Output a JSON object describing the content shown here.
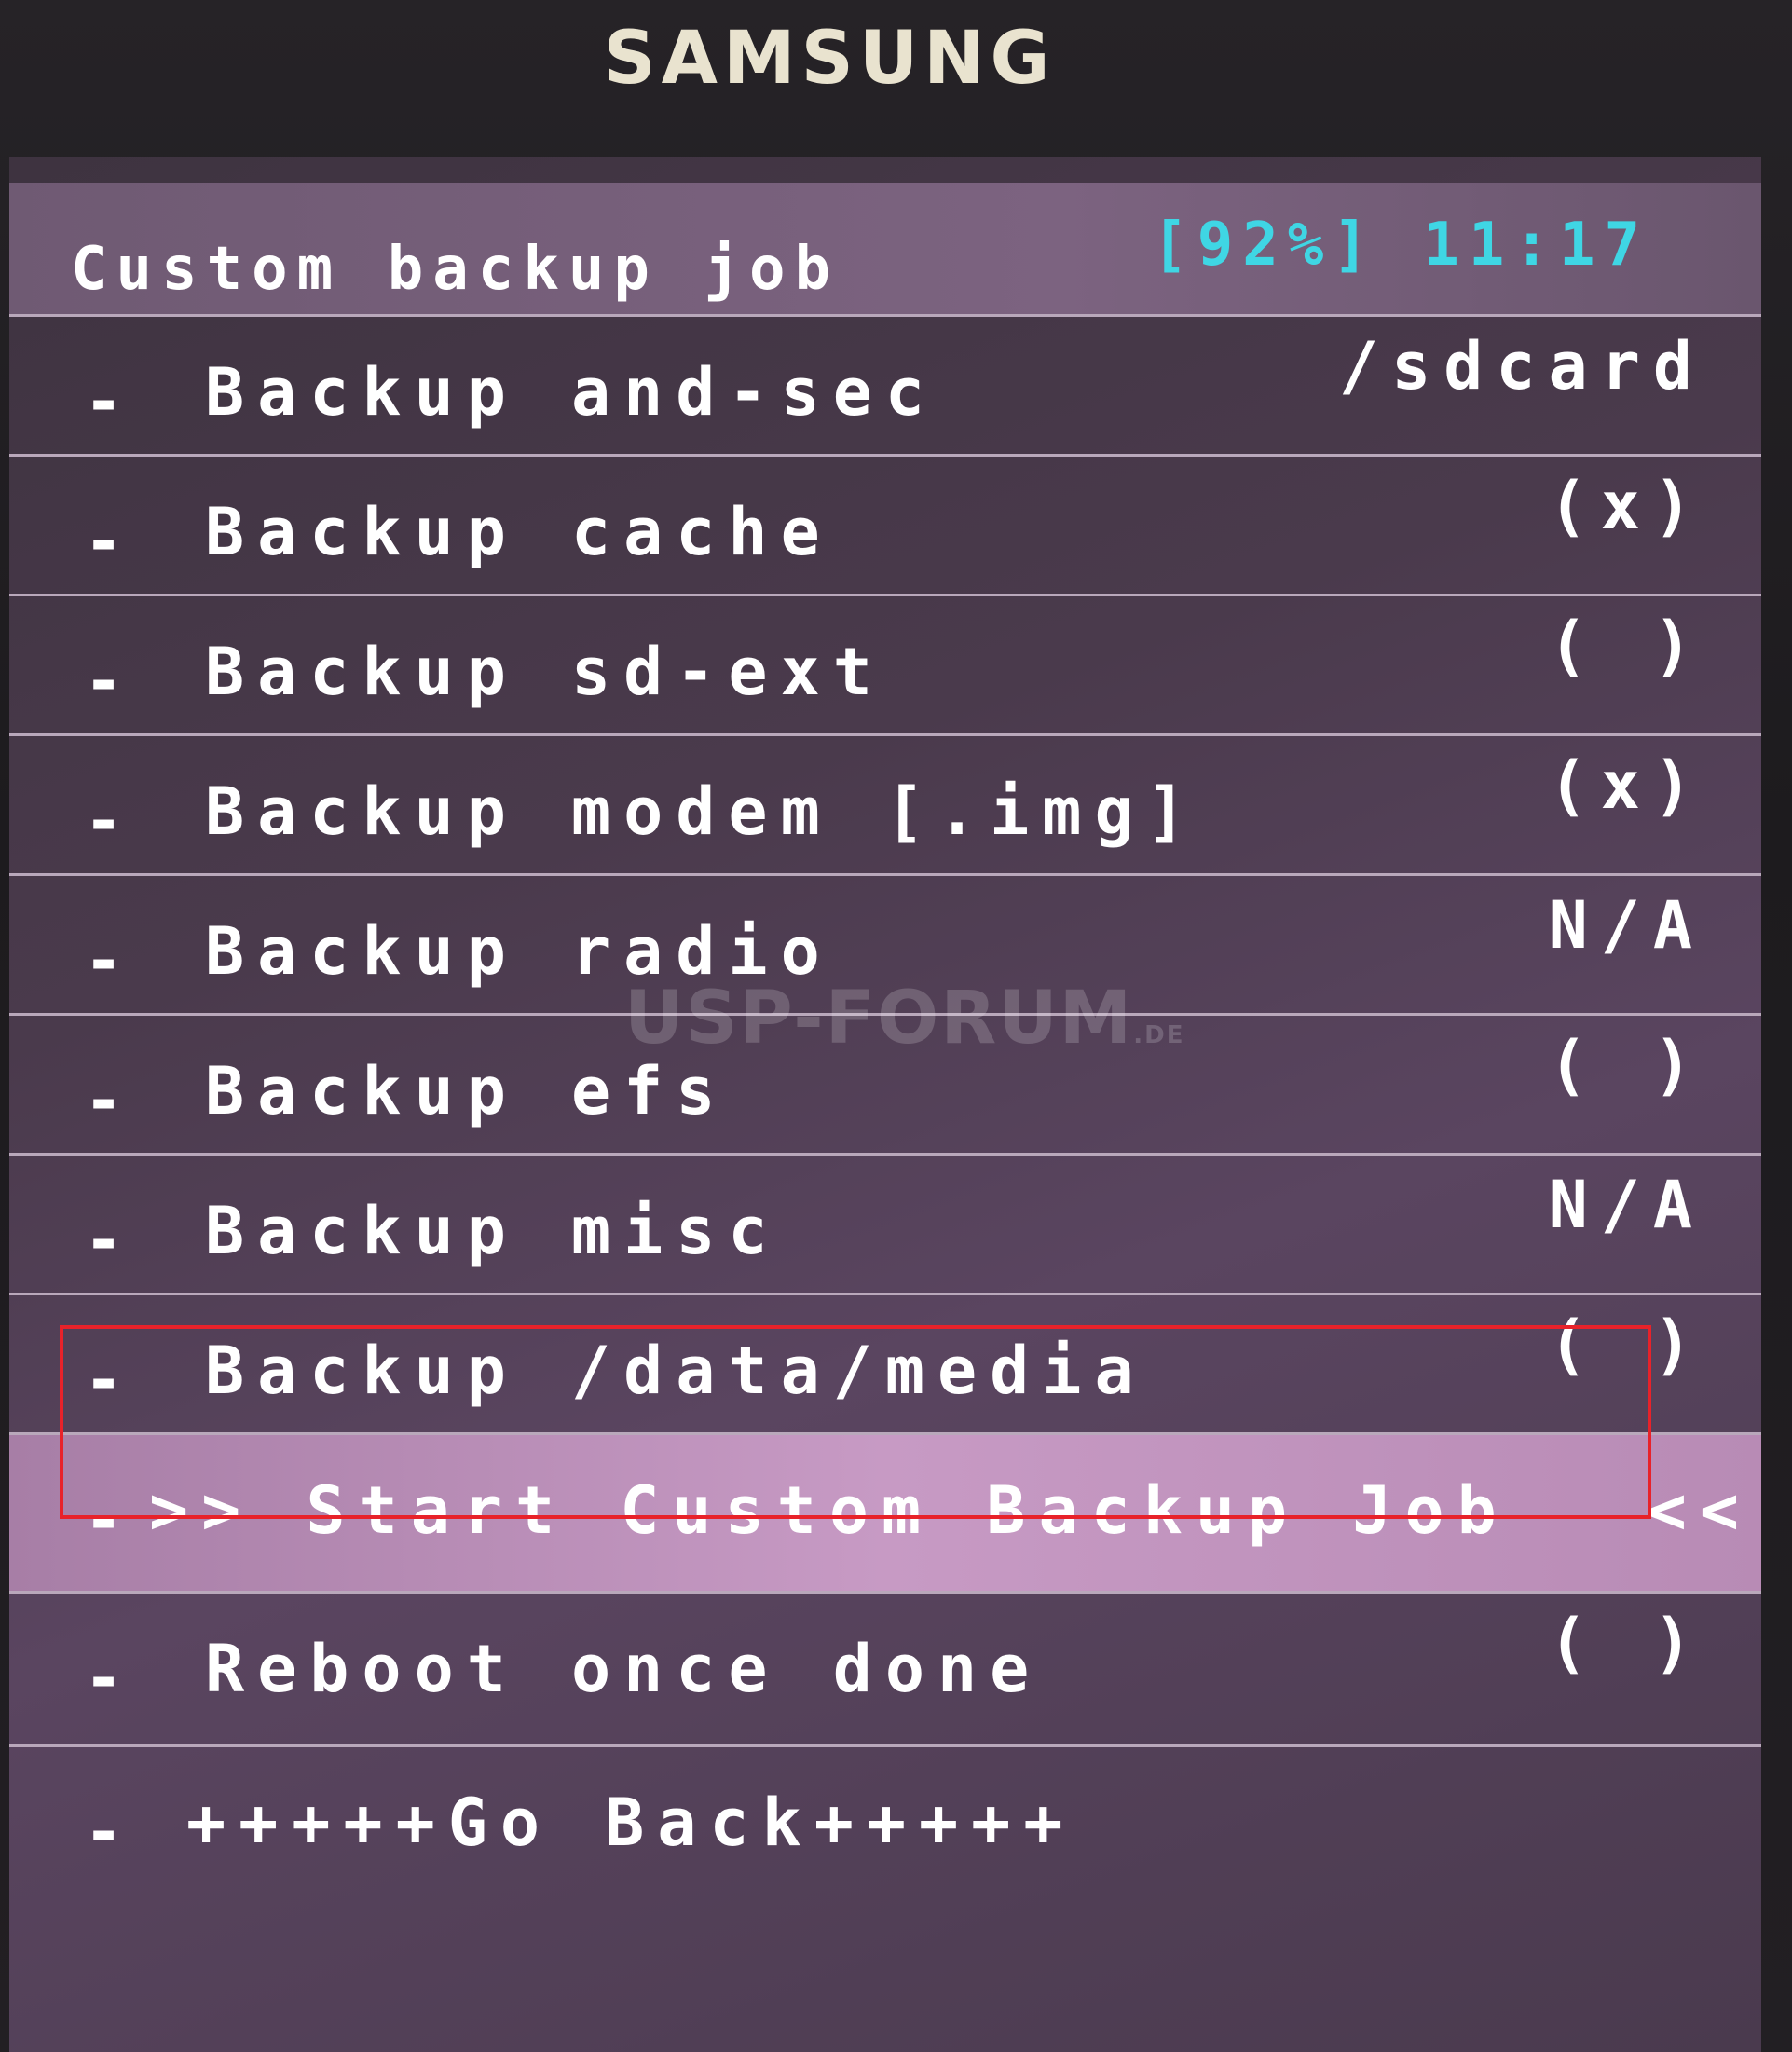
{
  "brand": "SAMSUNG",
  "header": {
    "title": "Custom backup job",
    "battery": "[92%]",
    "time": "11:17"
  },
  "menu": [
    {
      "label": "Backup and-sec",
      "value": "/sdcard"
    },
    {
      "label": "Backup cache",
      "value": "(x)"
    },
    {
      "label": "Backup sd-ext",
      "value": "( )"
    },
    {
      "label": "Backup modem [.img]",
      "value": "(x)"
    },
    {
      "label": "Backup radio",
      "value": "N/A"
    },
    {
      "label": "Backup efs",
      "value": "( )"
    },
    {
      "label": "Backup misc",
      "value": "N/A"
    },
    {
      "label": "Backup /data/media",
      "value": "( )"
    },
    {
      "label": ">> Start Custom Backup Job",
      "value": "<<"
    },
    {
      "label": "Reboot once done",
      "value": "( )"
    },
    {
      "label": "+++++Go Back+++++",
      "value": ""
    }
  ],
  "dash": "-",
  "selected_index": 8,
  "watermark": {
    "main": "USP-FORUM",
    "suffix": ".DE"
  },
  "colors": {
    "status": "#3fd6e4",
    "highlight_box": "#e8222a",
    "selected_row": "#c79ac4"
  }
}
